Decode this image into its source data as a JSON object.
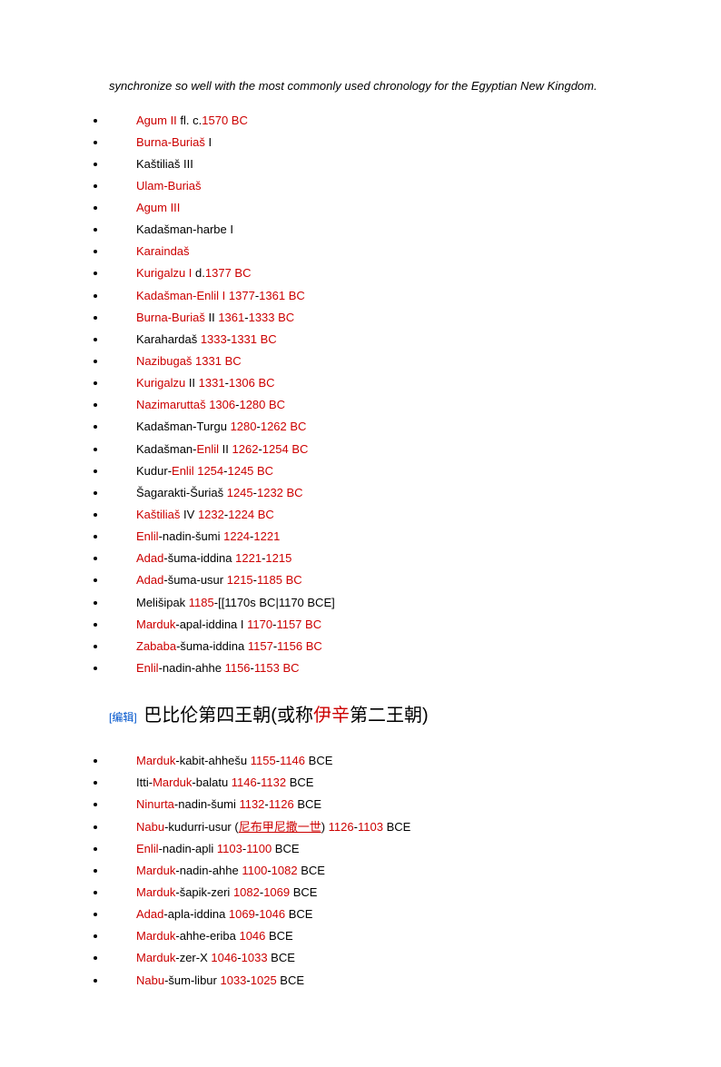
{
  "intro": "synchronize so well with the most commonly used chronology for the Egyptian New Kingdom.",
  "dynasty3": [
    {
      "parts": [
        {
          "t": "Agum II",
          "r": true
        },
        {
          "t": " fl. c.",
          "r": false
        },
        {
          "t": "1570 BC",
          "r": true
        }
      ]
    },
    {
      "parts": [
        {
          "t": "Burna-Buriaš",
          "r": true
        },
        {
          "t": " I",
          "r": false
        }
      ]
    },
    {
      "parts": [
        {
          "t": "Kaštiliaš III",
          "r": false
        }
      ]
    },
    {
      "parts": [
        {
          "t": "Ulam-Buriaš",
          "r": true
        }
      ]
    },
    {
      "parts": [
        {
          "t": "Agum III",
          "r": true
        }
      ]
    },
    {
      "parts": [
        {
          "t": "Kadašman-harbe I",
          "r": false
        }
      ]
    },
    {
      "parts": [
        {
          "t": "Karaindaš",
          "r": true
        }
      ]
    },
    {
      "parts": [
        {
          "t": "Kurigalzu I",
          "r": true
        },
        {
          "t": " d.",
          "r": false
        },
        {
          "t": "1377 BC",
          "r": true
        }
      ]
    },
    {
      "parts": [
        {
          "t": "Kadašman-Enlil I 1377",
          "r": true
        },
        {
          "t": "-",
          "r": false
        },
        {
          "t": "1361 BC",
          "r": true
        }
      ]
    },
    {
      "parts": [
        {
          "t": "Burna-Buriaš",
          "r": true
        },
        {
          "t": " II ",
          "r": false
        },
        {
          "t": "1361",
          "r": true
        },
        {
          "t": "-",
          "r": false
        },
        {
          "t": "1333 BC",
          "r": true
        }
      ]
    },
    {
      "parts": [
        {
          "t": "Karahardaš ",
          "r": false
        },
        {
          "t": "1333",
          "r": true
        },
        {
          "t": "-",
          "r": false
        },
        {
          "t": "1331 BC",
          "r": true
        }
      ]
    },
    {
      "parts": [
        {
          "t": "Nazibugaš 1331 BC",
          "r": true
        }
      ]
    },
    {
      "parts": [
        {
          "t": "Kurigalzu",
          "r": true
        },
        {
          "t": " II ",
          "r": false
        },
        {
          "t": "1331",
          "r": true
        },
        {
          "t": "-",
          "r": false
        },
        {
          "t": "1306 BC",
          "r": true
        }
      ]
    },
    {
      "parts": [
        {
          "t": "Nazimaruttaš 1306",
          "r": true
        },
        {
          "t": "-",
          "r": false
        },
        {
          "t": "1280 BC",
          "r": true
        }
      ]
    },
    {
      "parts": [
        {
          "t": "Kadašman-Turgu ",
          "r": false
        },
        {
          "t": "1280",
          "r": true
        },
        {
          "t": "-",
          "r": false
        },
        {
          "t": "1262 BC",
          "r": true
        }
      ]
    },
    {
      "parts": [
        {
          "t": "Kadašman-",
          "r": false
        },
        {
          "t": "Enlil",
          "r": true
        },
        {
          "t": " II ",
          "r": false
        },
        {
          "t": "1262",
          "r": true
        },
        {
          "t": "-",
          "r": false
        },
        {
          "t": "1254 BC",
          "r": true
        }
      ]
    },
    {
      "parts": [
        {
          "t": "Kudur-",
          "r": false
        },
        {
          "t": "Enlil 1254",
          "r": true
        },
        {
          "t": "-",
          "r": false
        },
        {
          "t": "1245 BC",
          "r": true
        }
      ]
    },
    {
      "parts": [
        {
          "t": "Šagarakti-Šuriaš ",
          "r": false
        },
        {
          "t": "1245",
          "r": true
        },
        {
          "t": "-",
          "r": false
        },
        {
          "t": "1232 BC",
          "r": true
        }
      ]
    },
    {
      "parts": [
        {
          "t": "Kaštiliaš",
          "r": true
        },
        {
          "t": " IV ",
          "r": false
        },
        {
          "t": "1232",
          "r": true
        },
        {
          "t": "-",
          "r": false
        },
        {
          "t": "1224 BC",
          "r": true
        }
      ]
    },
    {
      "parts": [
        {
          "t": "Enlil",
          "r": true
        },
        {
          "t": "-nadin-šumi ",
          "r": false
        },
        {
          "t": "1224",
          "r": true
        },
        {
          "t": "-",
          "r": false
        },
        {
          "t": "1221",
          "r": true
        }
      ]
    },
    {
      "parts": [
        {
          "t": "Adad",
          "r": true
        },
        {
          "t": "-šuma-iddina ",
          "r": false
        },
        {
          "t": "1221",
          "r": true
        },
        {
          "t": "-",
          "r": false
        },
        {
          "t": "1215",
          "r": true
        }
      ]
    },
    {
      "parts": [
        {
          "t": "Adad",
          "r": true
        },
        {
          "t": "-šuma-usur ",
          "r": false
        },
        {
          "t": "1215",
          "r": true
        },
        {
          "t": "-",
          "r": false
        },
        {
          "t": "1185 BC",
          "r": true
        }
      ]
    },
    {
      "parts": [
        {
          "t": "Melišipak ",
          "r": false
        },
        {
          "t": "1185",
          "r": true
        },
        {
          "t": "-[[1170s BC|1170 BCE]",
          "r": false
        }
      ]
    },
    {
      "parts": [
        {
          "t": "Marduk",
          "r": true
        },
        {
          "t": "-apal-iddina I ",
          "r": false
        },
        {
          "t": "1170",
          "r": true
        },
        {
          "t": "-",
          "r": false
        },
        {
          "t": "1157 BC",
          "r": true
        }
      ]
    },
    {
      "parts": [
        {
          "t": "Zababa",
          "r": true
        },
        {
          "t": "-šuma-iddina ",
          "r": false
        },
        {
          "t": "1157",
          "r": true
        },
        {
          "t": "-",
          "r": false
        },
        {
          "t": "1156 BC",
          "r": true
        }
      ]
    },
    {
      "parts": [
        {
          "t": "Enlil",
          "r": true
        },
        {
          "t": "-nadin-ahhe ",
          "r": false
        },
        {
          "t": "1156",
          "r": true
        },
        {
          "t": "-",
          "r": false
        },
        {
          "t": "1153 BC",
          "r": true
        }
      ]
    }
  ],
  "heading": {
    "edit": "[编辑]",
    "prefix": "巴比伦第四王朝(或称",
    "link": "伊辛",
    "suffix": "第二王朝)"
  },
  "dynasty4": [
    {
      "parts": [
        {
          "t": "Marduk",
          "r": true
        },
        {
          "t": "-kabit-ahhešu ",
          "r": false
        },
        {
          "t": "1155",
          "r": true
        },
        {
          "t": "-",
          "r": false
        },
        {
          "t": "1146",
          "r": true
        },
        {
          "t": " BCE",
          "r": false
        }
      ]
    },
    {
      "parts": [
        {
          "t": "Itti-",
          "r": false
        },
        {
          "t": "Marduk",
          "r": true
        },
        {
          "t": "-balatu ",
          "r": false
        },
        {
          "t": "1146",
          "r": true
        },
        {
          "t": "-",
          "r": false
        },
        {
          "t": "1132",
          "r": true
        },
        {
          "t": " BCE",
          "r": false
        }
      ]
    },
    {
      "parts": [
        {
          "t": "Ninurta",
          "r": true
        },
        {
          "t": "-nadin-šumi ",
          "r": false
        },
        {
          "t": "1132",
          "r": true
        },
        {
          "t": "-",
          "r": false
        },
        {
          "t": "1126",
          "r": true
        },
        {
          "t": " BCE",
          "r": false
        }
      ]
    },
    {
      "parts": [
        {
          "t": "Nabu",
          "r": true
        },
        {
          "t": "-kudurri-usur (",
          "r": false
        },
        {
          "t": "尼布甲尼撒一世",
          "r": true,
          "u": true
        },
        {
          "t": ") ",
          "r": false
        },
        {
          "t": "1126",
          "r": true
        },
        {
          "t": "-",
          "r": false
        },
        {
          "t": "1103",
          "r": true
        },
        {
          "t": " BCE",
          "r": false
        }
      ]
    },
    {
      "parts": [
        {
          "t": "Enlil",
          "r": true
        },
        {
          "t": "-nadin-apli ",
          "r": false
        },
        {
          "t": "1103",
          "r": true
        },
        {
          "t": "-",
          "r": false
        },
        {
          "t": "1100",
          "r": true
        },
        {
          "t": " BCE",
          "r": false
        }
      ]
    },
    {
      "parts": [
        {
          "t": "Marduk",
          "r": true
        },
        {
          "t": "-nadin-ahhe ",
          "r": false
        },
        {
          "t": "1100",
          "r": true
        },
        {
          "t": "-",
          "r": false
        },
        {
          "t": "1082",
          "r": true
        },
        {
          "t": " BCE",
          "r": false
        }
      ]
    },
    {
      "parts": [
        {
          "t": "Marduk",
          "r": true
        },
        {
          "t": "-šapik-zeri ",
          "r": false
        },
        {
          "t": "1082",
          "r": true
        },
        {
          "t": "-",
          "r": false
        },
        {
          "t": "1069",
          "r": true
        },
        {
          "t": " BCE",
          "r": false
        }
      ]
    },
    {
      "parts": [
        {
          "t": "Adad",
          "r": true
        },
        {
          "t": "-apla-iddina ",
          "r": false
        },
        {
          "t": "1069",
          "r": true
        },
        {
          "t": "-",
          "r": false
        },
        {
          "t": "1046",
          "r": true
        },
        {
          "t": " BCE",
          "r": false
        }
      ]
    },
    {
      "parts": [
        {
          "t": "Marduk",
          "r": true
        },
        {
          "t": "-ahhe-eriba ",
          "r": false
        },
        {
          "t": "1046",
          "r": true
        },
        {
          "t": " BCE",
          "r": false
        }
      ]
    },
    {
      "parts": [
        {
          "t": "Marduk",
          "r": true
        },
        {
          "t": "-zer-X ",
          "r": false
        },
        {
          "t": "1046",
          "r": true
        },
        {
          "t": "-",
          "r": false
        },
        {
          "t": "1033",
          "r": true
        },
        {
          "t": " BCE",
          "r": false
        }
      ]
    },
    {
      "parts": [
        {
          "t": "Nabu",
          "r": true
        },
        {
          "t": "-šum-libur ",
          "r": false
        },
        {
          "t": "1033",
          "r": true
        },
        {
          "t": "-",
          "r": false
        },
        {
          "t": "1025",
          "r": true
        },
        {
          "t": " BCE",
          "r": false
        }
      ]
    }
  ]
}
